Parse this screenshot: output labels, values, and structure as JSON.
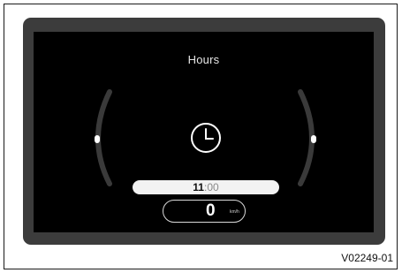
{
  "display": {
    "title": "Hours",
    "time_hours": "11",
    "time_separator": ":",
    "time_minutes": "00",
    "speed_value": "0",
    "speed_unit": "km/h"
  },
  "figure": {
    "reference": "V02249-01"
  },
  "icons": {
    "center": "clock-icon",
    "left_gauge": "left-arc-gauge",
    "right_gauge": "right-arc-gauge"
  },
  "colors": {
    "screen": "#000000",
    "bezel": "#3c3c3c",
    "gauge_arc": "#3a3a3a",
    "indicator": "#ffffff"
  }
}
